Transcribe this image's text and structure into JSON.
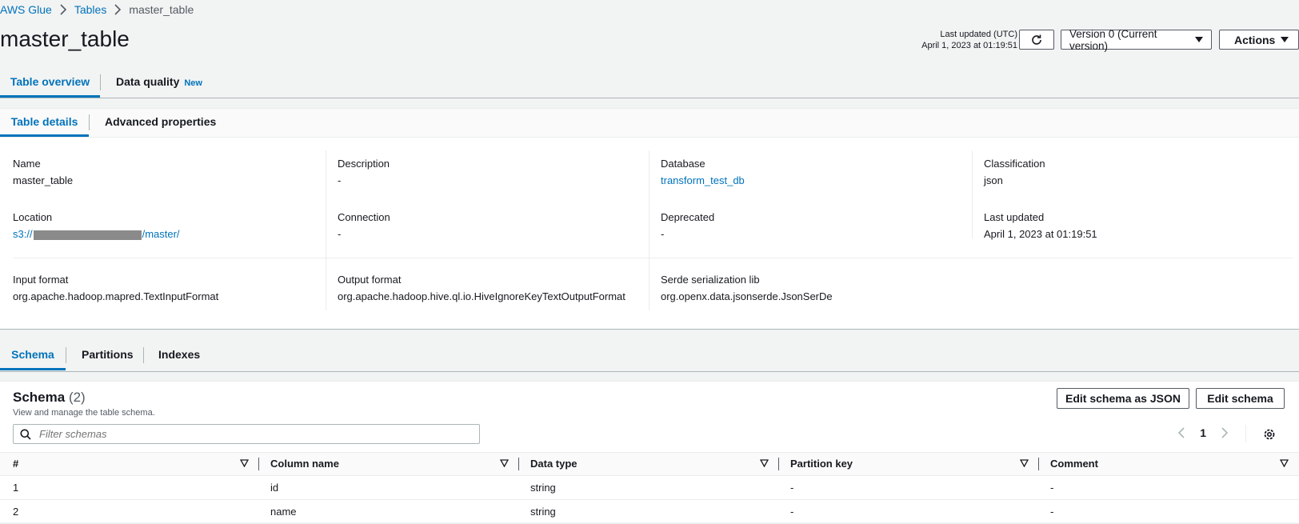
{
  "breadcrumb": {
    "root": "AWS Glue",
    "parent": "Tables",
    "current": "master_table"
  },
  "page_title": "master_table",
  "last_updated": {
    "label": "Last updated (UTC)",
    "value": "April 1, 2023 at 01:19:51"
  },
  "version_select": {
    "value": "Version 0 (Current version)"
  },
  "actions_label": "Actions",
  "top_tabs": {
    "overview": "Table overview",
    "quality": "Data quality",
    "quality_badge": "New"
  },
  "detail_tabs": {
    "details": "Table details",
    "advanced": "Advanced properties"
  },
  "details": {
    "name": {
      "label": "Name",
      "value": "master_table"
    },
    "description": {
      "label": "Description",
      "value": "-"
    },
    "database": {
      "label": "Database",
      "value": "transform_test_db"
    },
    "classification": {
      "label": "Classification",
      "value": "json"
    },
    "location": {
      "label": "Location",
      "prefix": "s3://",
      "suffix": "/master/"
    },
    "connection": {
      "label": "Connection",
      "value": "-"
    },
    "deprecated": {
      "label": "Deprecated",
      "value": "-"
    },
    "last_updated": {
      "label": "Last updated",
      "value": "April 1, 2023 at 01:19:51"
    },
    "input_format": {
      "label": "Input format",
      "value": "org.apache.hadoop.mapred.TextInputFormat"
    },
    "output_format": {
      "label": "Output format",
      "value": "org.apache.hadoop.hive.ql.io.HiveIgnoreKeyTextOutputFormat"
    },
    "serde": {
      "label": "Serde serialization lib",
      "value": "org.openx.data.jsonserde.JsonSerDe"
    }
  },
  "schema_tabs": {
    "schema": "Schema",
    "partitions": "Partitions",
    "indexes": "Indexes"
  },
  "schema": {
    "title": "Schema",
    "count": "(2)",
    "description": "View and manage the table schema.",
    "edit_json_label": "Edit schema as JSON",
    "edit_label": "Edit schema",
    "filter_placeholder": "Filter schemas",
    "page": "1",
    "columns": [
      "#",
      "Column name",
      "Data type",
      "Partition key",
      "Comment"
    ],
    "rows": [
      [
        "1",
        "id",
        "string",
        "-",
        "-"
      ],
      [
        "2",
        "name",
        "string",
        "-",
        "-"
      ]
    ]
  },
  "icons": {
    "refresh": "refresh-icon",
    "search": "search-icon",
    "settings": "gear-icon",
    "sort": "sort-down-icon"
  },
  "colors": {
    "link": "#0073bb",
    "active_tab": "#0073bb"
  }
}
